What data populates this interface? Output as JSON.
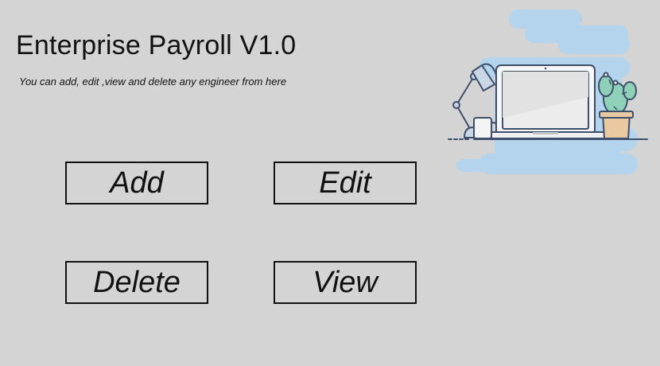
{
  "header": {
    "title": "Enterprise Payroll V1.0",
    "subtitle": "You can add, edit ,view and delete any engineer from here"
  },
  "actions": {
    "add_label": "Add",
    "edit_label": "Edit",
    "delete_label": "Delete",
    "view_label": "View"
  },
  "illustration": {
    "name": "laptop-desk-illustration",
    "colors": {
      "background": "#d4d4d4",
      "cloud": "#b3d4ec",
      "outline": "#3e4f6b",
      "screen": "#f0f0f0",
      "pot": "#e8c9a2",
      "cactus": "#8fd0b8"
    }
  }
}
